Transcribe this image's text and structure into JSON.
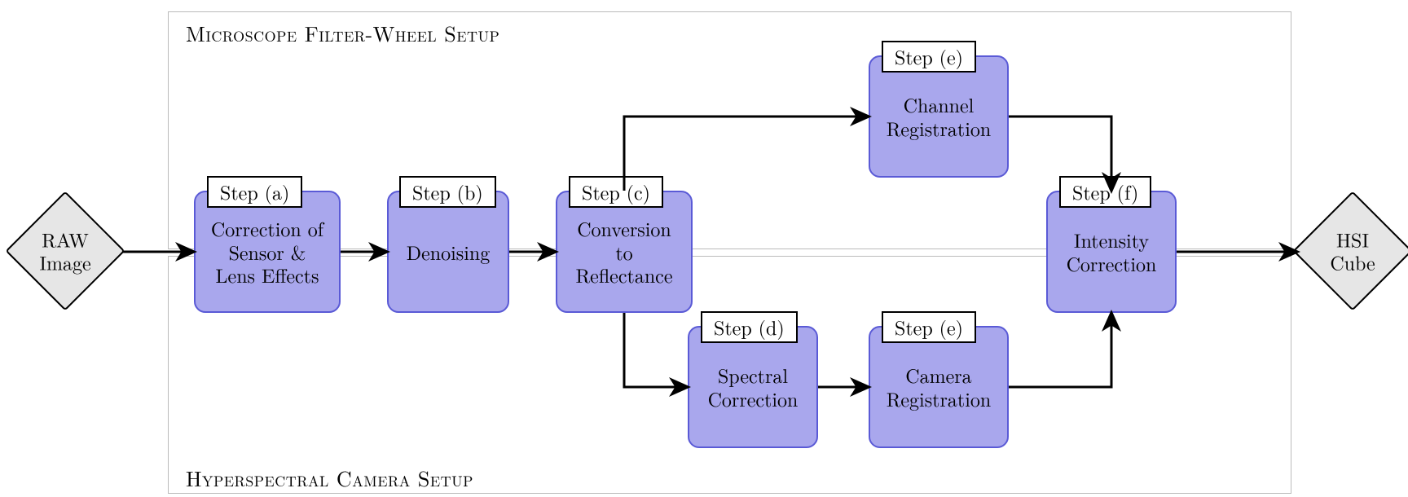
{
  "frames": {
    "top": {
      "title": "Microscope Filter-Wheel Setup"
    },
    "bottom": {
      "title": "Hyperspectral Camera Setup"
    }
  },
  "terminals": {
    "input": "RAW\nImage",
    "output": "HSI\nCube"
  },
  "steps": {
    "a": {
      "label": "Step (a)",
      "text": "Correction of\nSensor &\nLens Effects"
    },
    "b": {
      "label": "Step (b)",
      "text": "Denoising"
    },
    "c": {
      "label": "Step (c)",
      "text": "Conversion\nto\nReflectance"
    },
    "d_bottom": {
      "label": "Step (d)",
      "text": "Spectral\nCorrection"
    },
    "e_top": {
      "label": "Step (e)",
      "text": "Channel\nRegistration"
    },
    "e_bottom": {
      "label": "Step (e)",
      "text": "Camera\nRegistration"
    },
    "f": {
      "label": "Step (f)",
      "text": "Intensity\nCorrection"
    }
  }
}
